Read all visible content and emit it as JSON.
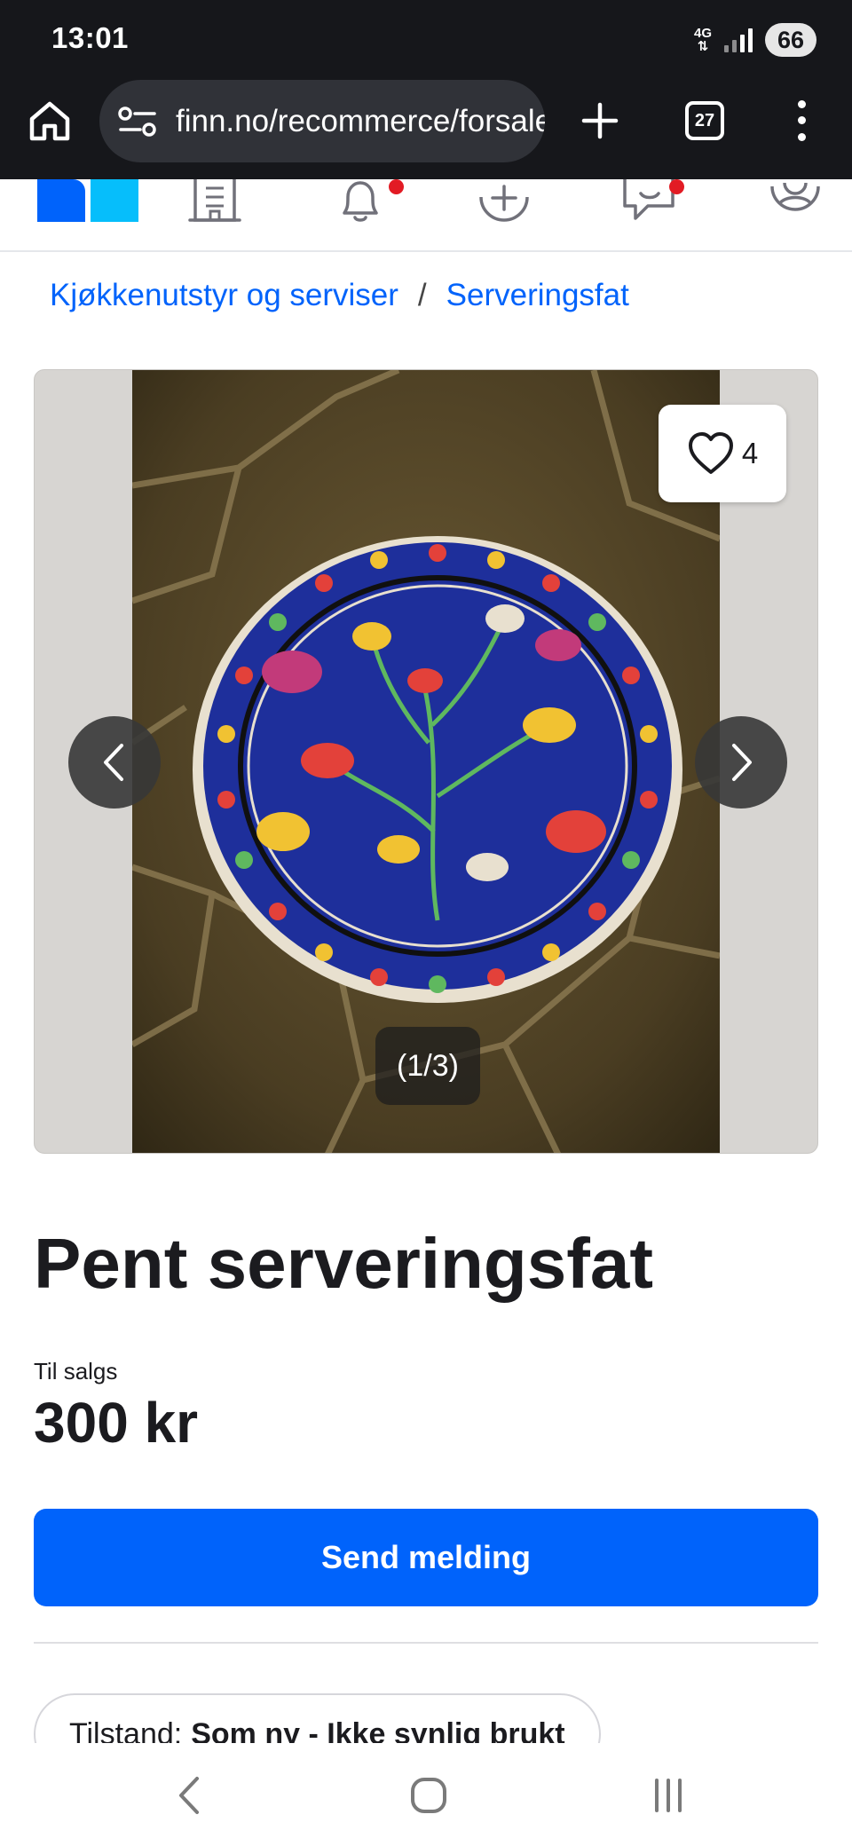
{
  "status_bar": {
    "time": "13:01",
    "network": "4G",
    "battery": "66"
  },
  "browser": {
    "url": "finn.no/recommerce/forsale/item",
    "tab_count": "27"
  },
  "site_nav": {
    "items": [
      "logo",
      "building-icon",
      "bell-icon",
      "add-circle-icon",
      "messages-icon",
      "profile-icon"
    ]
  },
  "breadcrumb": {
    "items": [
      "Kjøkkenutstyr og serviser",
      "Serveringsfat"
    ],
    "separator": "/"
  },
  "gallery": {
    "favorites_count": "4",
    "counter": "(1/3)"
  },
  "listing": {
    "title": "Pent serveringsfat",
    "status_label": "Til salgs",
    "price": "300 kr",
    "send_button": "Send melding",
    "condition_label": "Tilstand:",
    "condition_value": "Som ny - Ikke synlig brukt"
  },
  "colors": {
    "brand_blue": "#0063fb",
    "brand_light_blue": "#06befb",
    "notification_dot": "#e21b24"
  }
}
